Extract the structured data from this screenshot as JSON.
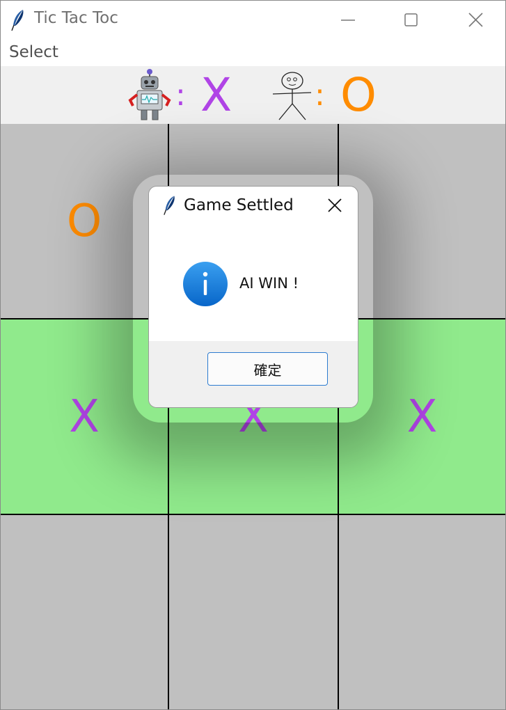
{
  "window": {
    "title": "Tic Tac Toc",
    "icon": "feather-icon"
  },
  "menu": {
    "items": [
      "Select"
    ]
  },
  "legend": {
    "ai": {
      "icon": "robot-icon",
      "separator": ":",
      "symbol": "X",
      "color": "#b044e6"
    },
    "human": {
      "icon": "stick-figure-icon",
      "separator": ":",
      "symbol": "O",
      "color": "#ff8c00"
    }
  },
  "board": {
    "cells": [
      [
        "O",
        "",
        ""
      ],
      [
        "X",
        "X",
        "X"
      ],
      [
        "",
        "",
        ""
      ]
    ],
    "winning_row": 1,
    "colors": {
      "cell": "#c0c0c0",
      "win": "#90ea8c",
      "x": "#b044e6",
      "o": "#ff8c00"
    }
  },
  "dialog": {
    "title": "Game Settled",
    "icon": "info-icon",
    "message": "AI WIN !",
    "ok_label": "確定"
  }
}
